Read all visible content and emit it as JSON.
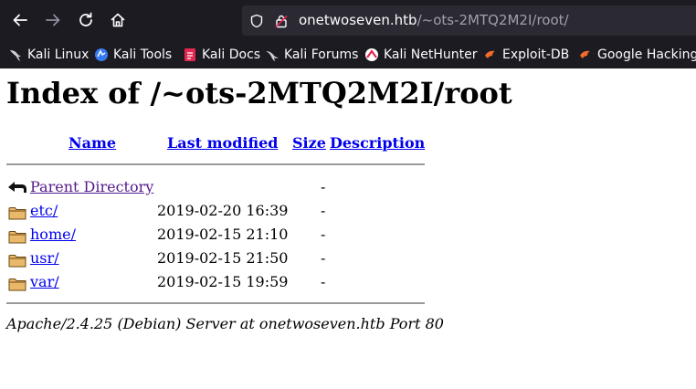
{
  "browser": {
    "url_host": "onetwoseven.htb",
    "url_path": "/~ots-2MTQ2M2I/root/",
    "bookmarks": [
      {
        "label": "Kali Linux",
        "icon": "kali-dragon-icon"
      },
      {
        "label": "Kali Tools",
        "icon": "kali-tools-icon"
      },
      {
        "label": "Kali Docs",
        "icon": "kali-docs-icon"
      },
      {
        "label": "Kali Forums",
        "icon": "kali-forums-icon"
      },
      {
        "label": "Kali NetHunter",
        "icon": "nethunter-icon"
      },
      {
        "label": "Exploit-DB",
        "icon": "exploit-db-icon"
      },
      {
        "label": "Google Hacking D",
        "icon": "ghdb-icon"
      }
    ]
  },
  "page": {
    "title": "Index of /~ots-2MTQ2M2I/root",
    "columns": {
      "name": "Name",
      "modified": "Last modified",
      "size": "Size",
      "description": "Description"
    },
    "rows": [
      {
        "name": "Parent Directory",
        "modified": "",
        "size": "-",
        "icon": "back-icon"
      },
      {
        "name": "etc/",
        "modified": "2019-02-20 16:39",
        "size": "-",
        "icon": "folder-icon"
      },
      {
        "name": "home/",
        "modified": "2019-02-15 21:10",
        "size": "-",
        "icon": "folder-icon"
      },
      {
        "name": "usr/",
        "modified": "2019-02-15 21:50",
        "size": "-",
        "icon": "folder-icon"
      },
      {
        "name": "var/",
        "modified": "2019-02-15 19:59",
        "size": "-",
        "icon": "folder-icon"
      }
    ],
    "server_signature": "Apache/2.4.25 (Debian) Server at onetwoseven.htb Port 80"
  },
  "colors": {
    "toolbar_bg": "#1c1b22",
    "urlbar_bg": "#2b2a33",
    "link": "#0000ee",
    "visited_link": "#551a8b"
  }
}
